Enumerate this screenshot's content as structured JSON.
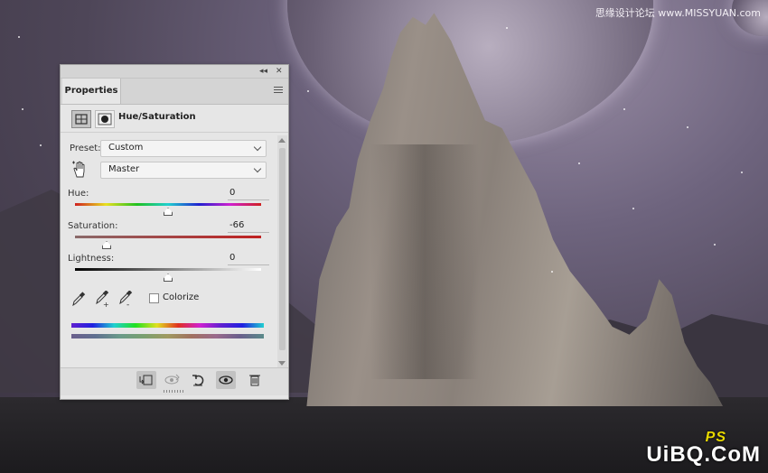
{
  "watermark_top": "思缘设计论坛 www.MISSYUAN.com",
  "watermark_bottom": "UiBQ.CoM",
  "watermark_ps": "PS",
  "panel": {
    "tab": "Properties",
    "collapse_glyph": "◂◂",
    "close_glyph": "✕",
    "adjustment_title": "Hue/Saturation",
    "preset_label": "Preset:",
    "preset_value": "Custom",
    "channel_value": "Master",
    "hue_label": "Hue:",
    "hue_value": "0",
    "saturation_label": "Saturation:",
    "saturation_value": "-66",
    "lightness_label": "Lightness:",
    "lightness_value": "0",
    "colorize_label": "Colorize",
    "colorize_checked": false,
    "sliders": {
      "hue": 0,
      "saturation": -66,
      "lightness": 0
    }
  },
  "icons": [
    "hue-saturation-adjustment-icon",
    "layer-mask-icon",
    "panel-menu-icon",
    "targeted-adjustment-hand-icon",
    "eyedropper-icon",
    "add-to-sample-eyedropper-icon",
    "subtract-from-sample-eyedropper-icon",
    "clip-to-layer-icon",
    "view-previous-state-icon",
    "reset-icon",
    "visibility-eye-icon",
    "delete-icon"
  ],
  "colors": {
    "panel_bg": "#e6e6e6",
    "titlebar_bg": "#d4d4d4",
    "saturation_track": "#b03030"
  }
}
